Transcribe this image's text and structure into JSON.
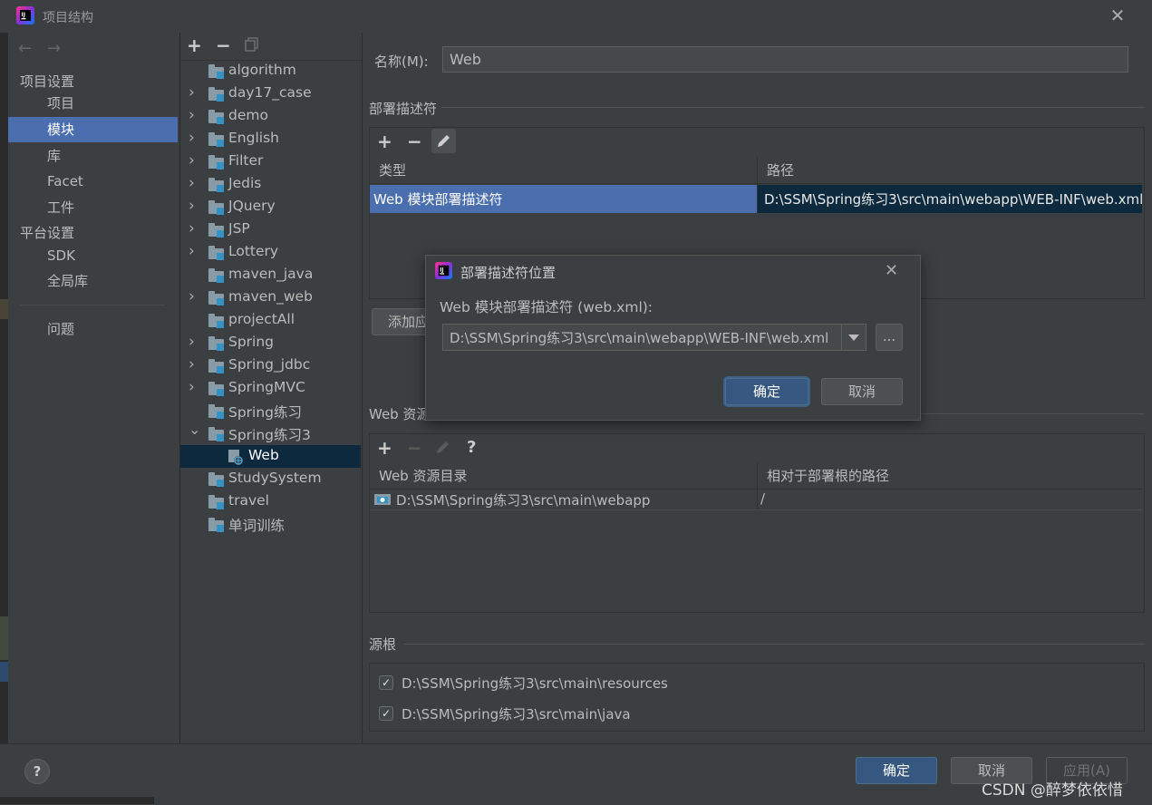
{
  "window": {
    "title": "项目结构"
  },
  "nav": {
    "sections": [
      {
        "label": "项目设置",
        "items": [
          "项目",
          "模块",
          "库",
          "Facet",
          "工件"
        ]
      },
      {
        "label": "平台设置",
        "items": [
          "SDK",
          "全局库"
        ]
      }
    ],
    "selected": "模块",
    "problems": "问题"
  },
  "module_tree": {
    "items": [
      {
        "label": "algorithm",
        "expandable": false
      },
      {
        "label": "day17_case",
        "expandable": true
      },
      {
        "label": "demo",
        "expandable": true
      },
      {
        "label": "English",
        "expandable": true
      },
      {
        "label": "Filter",
        "expandable": true
      },
      {
        "label": "Jedis",
        "expandable": true
      },
      {
        "label": "JQuery",
        "expandable": true
      },
      {
        "label": "JSP",
        "expandable": true
      },
      {
        "label": "Lottery",
        "expandable": true
      },
      {
        "label": "maven_java",
        "expandable": false
      },
      {
        "label": "maven_web",
        "expandable": true
      },
      {
        "label": "projectAll",
        "expandable": false
      },
      {
        "label": "Spring",
        "expandable": true
      },
      {
        "label": "Spring_jdbc",
        "expandable": true
      },
      {
        "label": "SpringMVC",
        "expandable": true
      },
      {
        "label": "Spring练习",
        "expandable": false
      },
      {
        "label": "Spring练习3",
        "expandable": true,
        "expanded": true
      },
      {
        "label": "Web",
        "child": true,
        "selected": true
      },
      {
        "label": "StudySystem",
        "expandable": false
      },
      {
        "label": "travel",
        "expandable": false
      },
      {
        "label": "单词训练",
        "expandable": false
      }
    ]
  },
  "detail": {
    "name_label": "名称(M):",
    "name_value": "Web",
    "deploy_group": "部署描述符",
    "deploy_table": {
      "headers": [
        "类型",
        "路径"
      ],
      "rows": [
        [
          "Web 模块部署描述符",
          "D:\\SSM\\Spring练习3\\src\\main\\webapp\\WEB-INF\\web.xml"
        ]
      ]
    },
    "add_button_partial": "添加应",
    "web_resource_group": "Web 资源",
    "web_resource_table": {
      "headers": [
        "Web 资源目录",
        "相对于部署根的路径"
      ],
      "rows": [
        [
          "D:\\SSM\\Spring练习3\\src\\main\\webapp",
          "/"
        ]
      ]
    },
    "source_roots_group": "源根",
    "source_roots": [
      {
        "path": "D:\\SSM\\Spring练习3\\src\\main\\resources",
        "checked": true
      },
      {
        "path": "D:\\SSM\\Spring练习3\\src\\main\\java",
        "checked": true
      }
    ]
  },
  "dialog": {
    "title": "部署描述符位置",
    "label": "Web 模块部署描述符 (web.xml):",
    "path_value": "D:\\SSM\\Spring练习3\\src\\main\\webapp\\WEB-INF\\web.xml",
    "browse_label": "...",
    "ok": "确定",
    "cancel": "取消"
  },
  "footer": {
    "help": "?",
    "ok": "确定",
    "cancel": "取消",
    "apply": "应用(A)"
  },
  "watermark": "CSDN @醉梦依依惜",
  "colors": {
    "selection": "#4b6eaf",
    "tree_selection": "#0d293e",
    "primary_button": "#365880",
    "background": "#3c3f41"
  }
}
